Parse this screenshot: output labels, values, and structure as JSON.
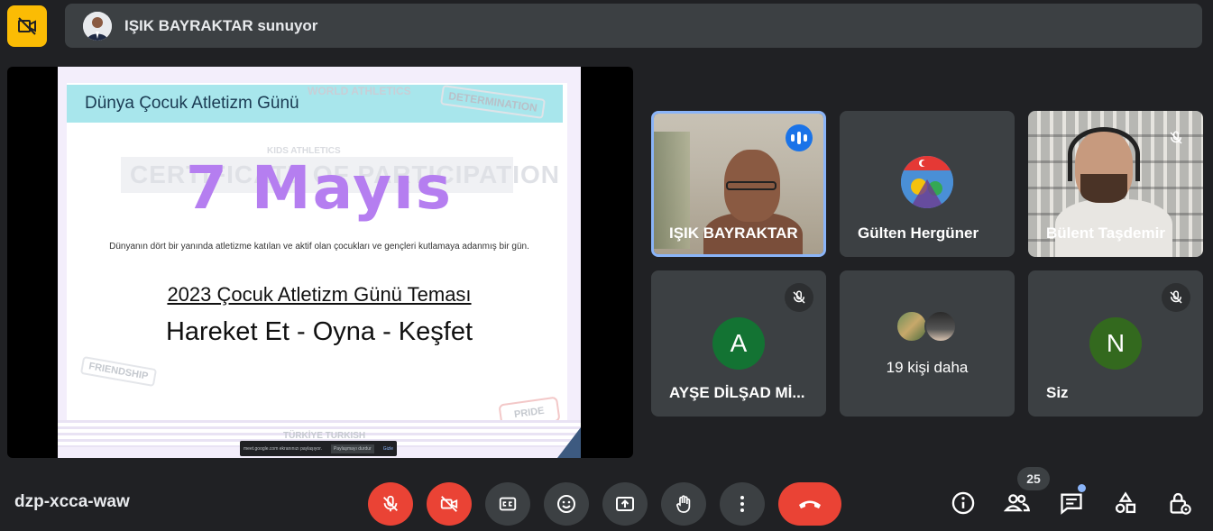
{
  "topbar": {
    "presenting_text": "IŞIK BAYRAKTAR sunuyor"
  },
  "slide": {
    "header": "Dünya Çocuk Atletizm Günü",
    "watermark_world": "WORLD ATHLETICS",
    "watermark_determination": "DETERMINATION",
    "watermark_kids": "KIDS ATHLETICS",
    "watermark_cert": "CERTIFICATE OF PARTICIPATION",
    "title": "7 Mayıs",
    "subtitle": "Dünyanın dört bir yanında atletizme katılan ve aktif olan çocukları ve gençleri kutlamaya adanmış bir gün.",
    "theme": "2023 Çocuk Atletizm Günü Teması",
    "motto": "Hareket Et - Oyna - Keşfet",
    "watermark_friendship": "FRIENDSHIP",
    "watermark_pride": "PRIDE",
    "logo_text": "TÜRKİYE TURKISH",
    "share_notice": "meet.google.com ekranınızı paylaşıyor.",
    "share_stop": "Paylaşmayı durdur",
    "share_hide": "Gizle"
  },
  "participants": [
    {
      "name": "IŞIK BAYRAKTAR",
      "state": "speaking"
    },
    {
      "name": "Gülten Hergüner",
      "state": "avatar"
    },
    {
      "name": "Bülent Taşdemir",
      "state": "muted"
    },
    {
      "name": "AYŞE DİLŞAD Mİ...",
      "initial": "A",
      "avatar_color": "#137333",
      "state": "muted"
    },
    {
      "more_text": "19 kişi daha"
    },
    {
      "name": "Siz",
      "initial": "N",
      "avatar_color": "#33691e",
      "state": "muted"
    }
  ],
  "bottombar": {
    "meeting_code": "dzp-xcca-waw",
    "participant_count": "25"
  },
  "colors": {
    "background": "#202124",
    "surface": "#3c4043",
    "danger": "#ea4335",
    "accent": "#8ab4f8",
    "warning": "#fbbc04",
    "slide_title": "#b57ef0"
  },
  "icons": [
    "no-camera-icon",
    "mic-off-icon",
    "camera-off-icon",
    "captions-icon",
    "emoji-icon",
    "present-icon",
    "hand-icon",
    "more-icon",
    "end-call-icon",
    "info-icon",
    "people-icon",
    "chat-icon",
    "activities-icon",
    "host-controls-icon"
  ]
}
